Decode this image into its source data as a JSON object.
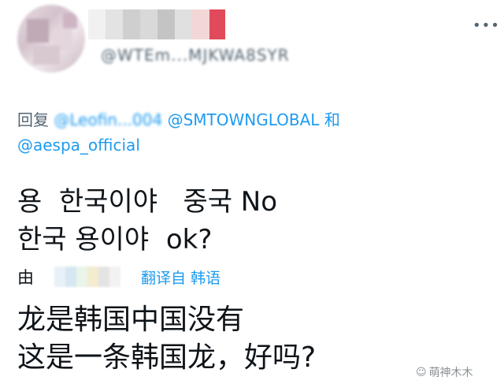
{
  "tweet": {
    "author_handle": "@WTEm...MJKWA8SYR",
    "more_glyph": "•••",
    "reply": {
      "prefix": "回复",
      "mention1": "@Leofin...004",
      "mention2": "@SMTOWNGLOBAL",
      "conjunction": "和",
      "mention3": "@aespa_official"
    },
    "korean_line1": "용  한국이야   중국 No",
    "korean_line2": "한국 용이야  ok?",
    "translation": {
      "by_label": "由",
      "translate_label": "翻译自 韩语"
    },
    "chinese_line1": "龙是韩国中国没有",
    "chinese_line2": "这是一条韩国龙，好吗?"
  },
  "watermark": {
    "icon": "cat-paw-icon",
    "text": "萌神木木"
  }
}
